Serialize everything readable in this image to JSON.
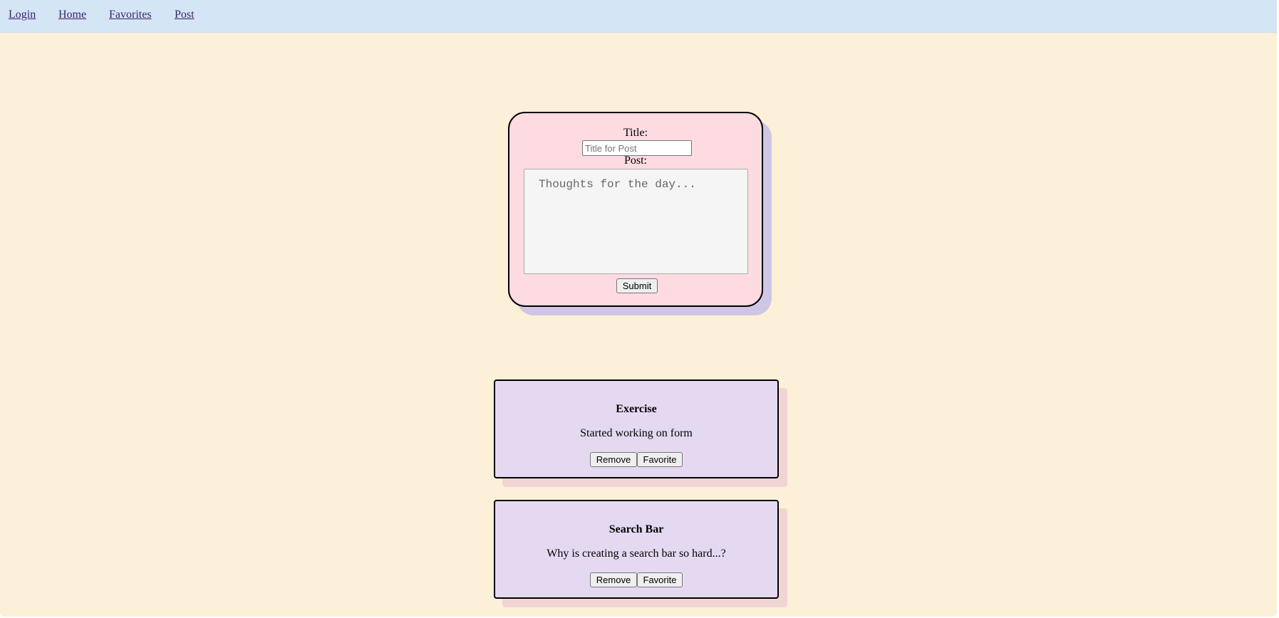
{
  "nav": {
    "items": [
      {
        "label": "Login"
      },
      {
        "label": "Home"
      },
      {
        "label": "Favorites"
      },
      {
        "label": "Post"
      }
    ]
  },
  "form": {
    "title_label": "Title:",
    "title_placeholder": "Title for Post",
    "post_label": "Post:",
    "post_placeholder": "Thoughts for the day...",
    "submit_label": "Submit"
  },
  "posts": [
    {
      "title": "Exercise",
      "body": "Started working on form",
      "remove_label": "Remove",
      "favorite_label": "Favorite"
    },
    {
      "title": "Search Bar",
      "body": "Why is creating a search bar so hard...?",
      "remove_label": "Remove",
      "favorite_label": "Favorite"
    }
  ],
  "colors": {
    "page_background": "#fdf0d8",
    "navbar_background": "#d4e6f5",
    "link_color": "#3a1f6e",
    "form_card_background": "#fddbe0",
    "form_card_shadow": "#cfc6e6",
    "post_card_background": "#e5d9f2",
    "post_card_shadow": "#f1d5d5"
  }
}
